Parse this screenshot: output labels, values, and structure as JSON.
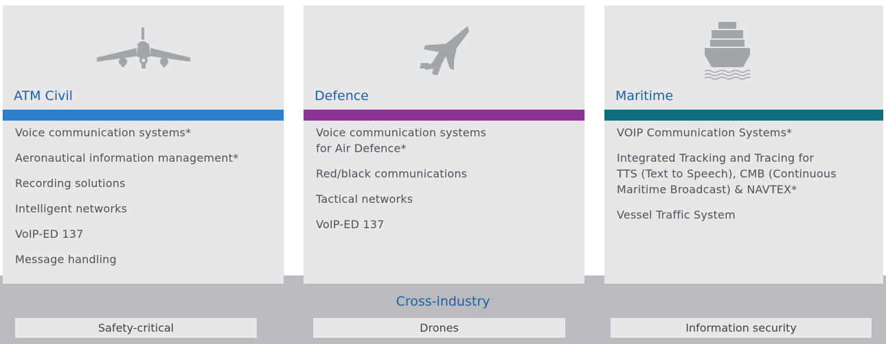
{
  "colors": {
    "atm_accent": "#2a7fc8",
    "defence_accent": "#8a3393",
    "maritime_accent": "#0e6f7e",
    "title_text": "#1f5fa8",
    "card_bg": "#e6e7e9",
    "band_bg": "#b9bbbe",
    "icon_fill": "#a2a5a9"
  },
  "columns": [
    {
      "id": "atm",
      "icon": "airplane-icon",
      "title": "ATM Civil",
      "items": [
        "Voice communication systems*",
        "Aeronautical information management*",
        "Recording solutions",
        "Intelligent networks",
        "VoIP-ED 137",
        "Message handling"
      ]
    },
    {
      "id": "defence",
      "icon": "fighter-jet-icon",
      "title": "Defence",
      "items": [
        [
          "Voice communication systems",
          "for Air Defence*"
        ],
        "Red/black communications",
        "Tactical networks",
        "VoIP-ED 137"
      ]
    },
    {
      "id": "maritime",
      "icon": "ship-icon",
      "title": "Maritime",
      "items": [
        "VOIP Communication Systems*",
        [
          "Integrated Tracking and Tracing for",
          "TTS (Text to Speech), CMB (Continuous",
          "Maritime Broadcast) & NAVTEX*"
        ],
        "Vessel Traffic System"
      ]
    }
  ],
  "cross_industry": {
    "title": "Cross-industry",
    "tags": [
      "Safety-critical",
      "Drones",
      "Information security"
    ]
  }
}
